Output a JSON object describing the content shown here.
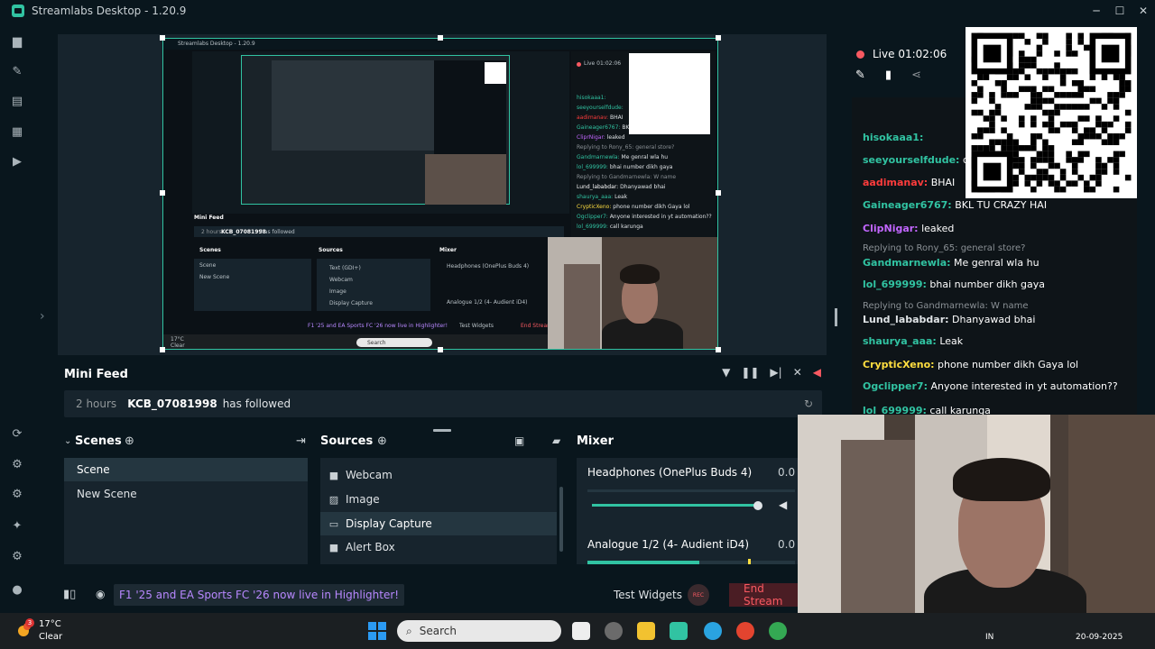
{
  "window": {
    "title": "Streamlabs Desktop - 1.20.9",
    "min": "─",
    "max": "☐",
    "close": "✕"
  },
  "sidebar": {
    "icons": [
      "editor-icon",
      "themes-icon",
      "store-icon",
      "layout-icon",
      "play-icon",
      "cloudbot-icon",
      "alerts-icon",
      "settings-plug-icon",
      "ai-sparkle-icon",
      "gear-icon",
      "profile-icon"
    ]
  },
  "preview": {
    "nested_title": "Streamlabs Desktop - 1.20.9",
    "nested_live": "Live 01:02:06",
    "nested_minifeed": "Mini Feed",
    "nested_followed_time": "2 hours",
    "nested_followed_user": "KCB_07081998",
    "nested_followed_action": "has followed",
    "nested_scenes": "Scenes",
    "nested_sources": "Sources",
    "nested_mixer": "Mixer",
    "nested_scene_1": "Scene",
    "nested_scene_2": "New Scene",
    "nested_src_1": "Text (GDI+)",
    "nested_src_2": "Webcam",
    "nested_src_3": "Image",
    "nested_src_4": "Display Capture",
    "nested_mixer_1": "Headphones (OnePlus Buds 4)",
    "nested_mixer_2": "Analogue 1/2 (4- Audient iD4)",
    "nested_test": "Test Widgets",
    "nested_end": "End Stream",
    "nested_notif": "F1 '25 and EA Sports FC '26 now live in Highlighter!",
    "nested_search": "Search",
    "nested_temp": "17°C",
    "nested_cond": "Clear",
    "nested_chat": [
      {
        "name": "hisokaaa1:",
        "msg": "",
        "color": "#31c3a2"
      },
      {
        "name": "seeyourselfdude:",
        "msg": "",
        "color": "#31c3a2"
      },
      {
        "name": "aadimanav:",
        "msg": "BHAI",
        "color": "#ff3c3c"
      },
      {
        "name": "Gaineager6767:",
        "msg": "BKL TU CRAZY HAI",
        "color": "#31c3a2"
      },
      {
        "name": "CliprNigar:",
        "msg": "leaked",
        "color": "#c266ff"
      },
      {
        "name": "Replying to Rony_65: general store?",
        "msg": "",
        "color": "#8a9095"
      },
      {
        "name": "Gandmarnewla:",
        "msg": "Me genral wla hu",
        "color": "#31c3a2"
      },
      {
        "name": "lol_699999:",
        "msg": "bhai number dikh gaya",
        "color": "#31c3a2"
      },
      {
        "name": "Replying to Gandmarnewla: W name",
        "msg": "",
        "color": "#8a9095"
      },
      {
        "name": "Lund_lababdar:",
        "msg": "Dhanyawad bhai",
        "color": "#fff"
      },
      {
        "name": "shaurya_aaa:",
        "msg": "Leak",
        "color": "#31c3a2"
      },
      {
        "name": "CrypticXeno:",
        "msg": "phone number dikh Gaya lol",
        "color": "#ffde40"
      },
      {
        "name": "Ogclipper7:",
        "msg": "Anyone interested in yt automation??",
        "color": "#31c3a2"
      },
      {
        "name": "lol_699999:",
        "msg": "call karunga",
        "color": "#31c3a2"
      }
    ]
  },
  "minifeed": {
    "title": "Mini Feed",
    "time": "2 hours",
    "user": "KCB_07081998",
    "action": "has followed"
  },
  "scenes": {
    "title": "Scenes",
    "items": [
      "Scene",
      "New Scene"
    ]
  },
  "sources": {
    "title": "Sources",
    "items": [
      "Webcam",
      "Image",
      "Display Capture",
      "Alert Box"
    ]
  },
  "mixer": {
    "title": "Mixer",
    "items": [
      {
        "name": "Headphones (OnePlus Buds 4)",
        "value": "0.0 d"
      },
      {
        "name": "Analogue 1/2 (4- Audient iD4)",
        "value": "0.0 d"
      }
    ],
    "headphones_volume_fraction": 0.88,
    "analogue_level_fraction": 0.52
  },
  "bottombar": {
    "notification": "F1 '25 and EA Sports FC '26 now live in Highlighter!",
    "test_widgets": "Test Widgets",
    "rec": "REC",
    "end_stream": "End Stream"
  },
  "chat": {
    "live_label": "Live",
    "live_time": "01:02:06",
    "messages": [
      {
        "name": "hisokaaa1:",
        "msg": "",
        "color": "#31c3a2"
      },
      {
        "name": "seeyourselfdude:",
        "msg": "dek",
        "color": "#31c3a2"
      },
      {
        "name": "aadimanav:",
        "msg": "BHAI",
        "color": "#ff3c3c"
      },
      {
        "name": "Gaineager6767:",
        "msg": "BKL TU CRAZY HAI",
        "color": "#31c3a2"
      },
      {
        "name": "ClipNigar:",
        "msg": "leaked",
        "color": "#c266ff"
      },
      {
        "name": "",
        "msg": "Replying to Rony_65: general store?",
        "color": "#8a9095",
        "reply": true
      },
      {
        "name": "Gandmarnewla:",
        "msg": "Me genral wla hu",
        "color": "#31c3a2"
      },
      {
        "name": "lol_699999:",
        "msg": "bhai number dikh gaya",
        "color": "#31c3a2"
      },
      {
        "name": "",
        "msg": "Replying to Gandmarnewla: W name",
        "color": "#8a9095",
        "reply": true
      },
      {
        "name": "Lund_lababdar:",
        "msg": "Dhanyawad bhai",
        "color": "#dfe3e6"
      },
      {
        "name": "shaurya_aaa:",
        "msg": "Leak",
        "color": "#31c3a2"
      },
      {
        "name": "CrypticXeno:",
        "msg": "phone number dikh Gaya lol",
        "color": "#ffde40"
      },
      {
        "name": "Ogclipper7:",
        "msg": "Anyone interested in yt automation??",
        "color": "#31c3a2"
      },
      {
        "name": "lol_699999:",
        "msg": "call karunga",
        "color": "#31c3a2"
      }
    ]
  },
  "taskbar": {
    "weather_temp": "17°C",
    "weather_cond": "Clear",
    "weather_badge": "3",
    "search": "Search",
    "tray_lang": "IN",
    "tray_date": "20-09-2025"
  },
  "colors": {
    "accent": "#31c3a2",
    "live_red": "#f85961",
    "panel": "#17242d",
    "bg": "#09161d"
  }
}
